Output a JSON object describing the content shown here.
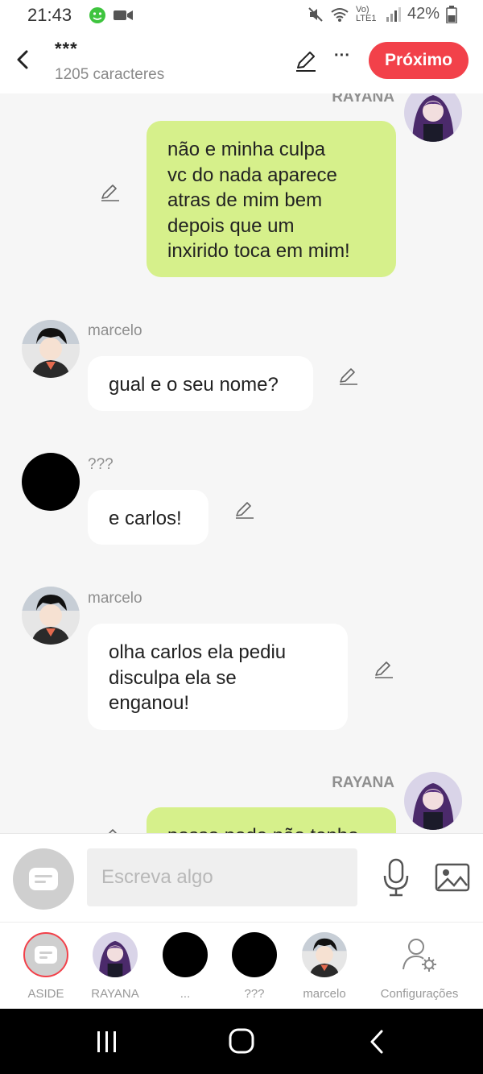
{
  "status": {
    "time": "21:43",
    "network": "Vo) LTE1",
    "battery": "42%"
  },
  "header": {
    "title": "***",
    "subtitle": "1205 caracteres",
    "next_label": "Próximo"
  },
  "messages": [
    {
      "side": "right",
      "author": "RAYANA",
      "lines": [
        "não e minha culpa",
        "vc do nada aparece",
        "atras de mim bem",
        "depois que um",
        "inxirido toca em mim!"
      ]
    },
    {
      "side": "left",
      "author": "marcelo",
      "lines": [
        "gual e o seu nome?"
      ]
    },
    {
      "side": "left",
      "author": "???",
      "lines": [
        "e carlos!"
      ]
    },
    {
      "side": "left",
      "author": "marcelo",
      "lines": [
        "olha carlos ela pediu",
        "disculpa ela se",
        "enganou!"
      ]
    },
    {
      "side": "right",
      "author": "RAYANA",
      "lines": [
        "posso pode não tenho"
      ]
    }
  ],
  "composer": {
    "placeholder": "Escreva algo"
  },
  "tabs": [
    {
      "label": "ASIDE"
    },
    {
      "label": "RAYANA"
    },
    {
      "label": "..."
    },
    {
      "label": "???"
    },
    {
      "label": "marcelo"
    },
    {
      "label": "Configurações"
    }
  ],
  "colors": {
    "accent": "#f2414a",
    "bubble_green": "#d6f08b",
    "bubble_white": "#ffffff",
    "background": "#f6f6f6"
  },
  "icons": [
    "back-arrow-icon",
    "edit-icon",
    "more-icon",
    "pencil-icon",
    "chat-bubble-icon",
    "microphone-icon",
    "image-icon",
    "settings-user-icon",
    "recents-icon",
    "home-icon",
    "back-nav-icon"
  ]
}
